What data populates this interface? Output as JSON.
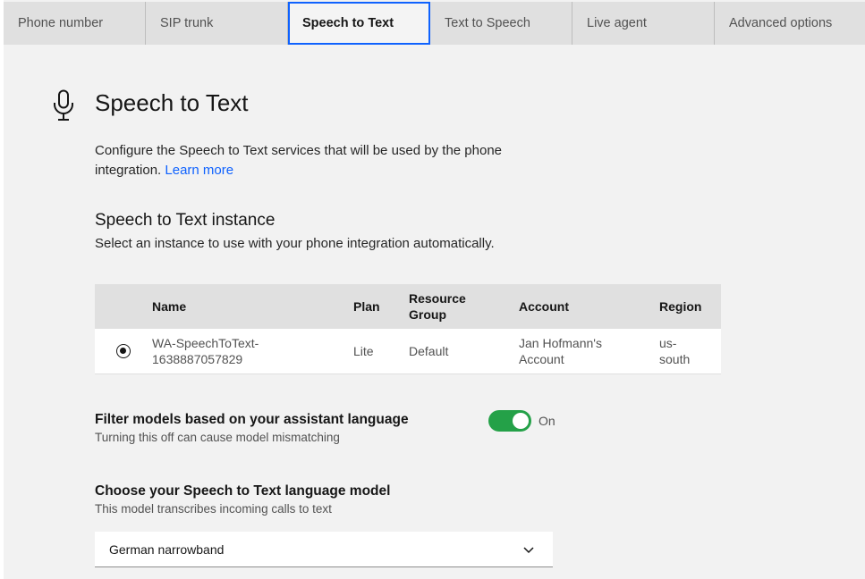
{
  "tabs": [
    {
      "label": "Phone number"
    },
    {
      "label": "SIP trunk"
    },
    {
      "label": "Speech to Text"
    },
    {
      "label": "Text to Speech"
    },
    {
      "label": "Live agent"
    },
    {
      "label": "Advanced options"
    }
  ],
  "active_tab": "Speech to Text",
  "header": {
    "icon": "microphone-icon",
    "title": "Speech to Text",
    "description": "Configure the Speech to Text services that will be used by the phone integration.",
    "learn_more": "Learn more"
  },
  "instance": {
    "title": "Speech to Text instance",
    "subtitle": "Select an instance to use with your phone integration automatically.",
    "columns": {
      "name": "Name",
      "plan": "Plan",
      "group_line1": "Resource",
      "group_line2": "Group",
      "account": "Account",
      "region": "Region"
    },
    "rows": [
      {
        "selected": true,
        "name_line1": "WA-SpeechToText-",
        "name_line2": "1638887057829",
        "plan": "Lite",
        "group": "Default",
        "account_line1": "Jan Hofmann's",
        "account_line2": "Account",
        "region_line1": "us-",
        "region_line2": "south"
      }
    ]
  },
  "filter": {
    "label": "Filter models based on your assistant language",
    "helper": "Turning this off can cause model mismatching",
    "enabled": true,
    "state_label": "On",
    "toggle_color": "#24a148"
  },
  "model": {
    "label": "Choose your Speech to Text language model",
    "helper": "This model transcribes incoming calls to text",
    "selected": "German narrowband",
    "icon": "chevron-down-icon"
  },
  "colors": {
    "link": "#0f62fe",
    "active_tab_border": "#0f62fe",
    "panel_bg": "#f2f2f2"
  }
}
